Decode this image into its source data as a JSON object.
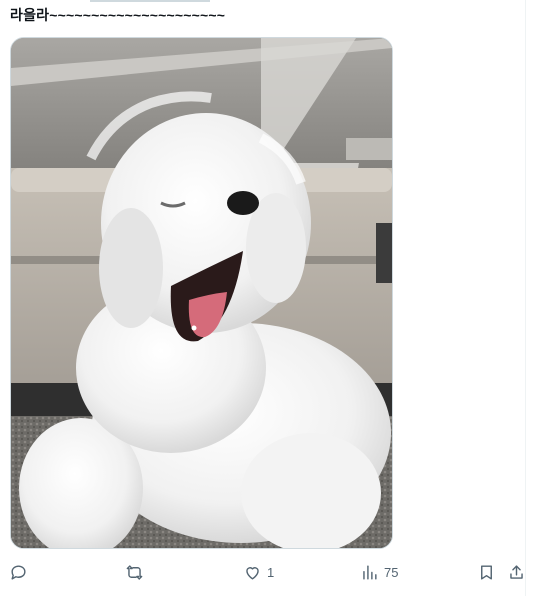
{
  "tweet": {
    "text": "라을라~~~~~~~~~~~~~~~~~~~~~",
    "media_alt": "white fluffy dog yawning on a carpet"
  },
  "actions": {
    "reply_count": "",
    "retweet_count": "",
    "like_count": "1",
    "views_count": "75"
  },
  "icons": [
    "reply-icon",
    "retweet-icon",
    "like-icon",
    "views-icon",
    "bookmark-icon",
    "share-icon"
  ]
}
